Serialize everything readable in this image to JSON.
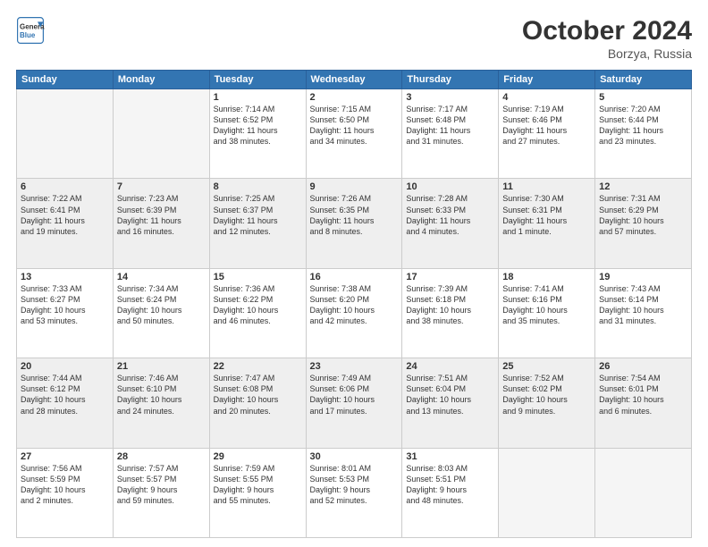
{
  "header": {
    "logo_line1": "General",
    "logo_line2": "Blue",
    "month_year": "October 2024",
    "location": "Borzya, Russia"
  },
  "weekdays": [
    "Sunday",
    "Monday",
    "Tuesday",
    "Wednesday",
    "Thursday",
    "Friday",
    "Saturday"
  ],
  "weeks": [
    [
      {
        "day": "",
        "info": ""
      },
      {
        "day": "",
        "info": ""
      },
      {
        "day": "1",
        "info": "Sunrise: 7:14 AM\nSunset: 6:52 PM\nDaylight: 11 hours\nand 38 minutes."
      },
      {
        "day": "2",
        "info": "Sunrise: 7:15 AM\nSunset: 6:50 PM\nDaylight: 11 hours\nand 34 minutes."
      },
      {
        "day": "3",
        "info": "Sunrise: 7:17 AM\nSunset: 6:48 PM\nDaylight: 11 hours\nand 31 minutes."
      },
      {
        "day": "4",
        "info": "Sunrise: 7:19 AM\nSunset: 6:46 PM\nDaylight: 11 hours\nand 27 minutes."
      },
      {
        "day": "5",
        "info": "Sunrise: 7:20 AM\nSunset: 6:44 PM\nDaylight: 11 hours\nand 23 minutes."
      }
    ],
    [
      {
        "day": "6",
        "info": "Sunrise: 7:22 AM\nSunset: 6:41 PM\nDaylight: 11 hours\nand 19 minutes."
      },
      {
        "day": "7",
        "info": "Sunrise: 7:23 AM\nSunset: 6:39 PM\nDaylight: 11 hours\nand 16 minutes."
      },
      {
        "day": "8",
        "info": "Sunrise: 7:25 AM\nSunset: 6:37 PM\nDaylight: 11 hours\nand 12 minutes."
      },
      {
        "day": "9",
        "info": "Sunrise: 7:26 AM\nSunset: 6:35 PM\nDaylight: 11 hours\nand 8 minutes."
      },
      {
        "day": "10",
        "info": "Sunrise: 7:28 AM\nSunset: 6:33 PM\nDaylight: 11 hours\nand 4 minutes."
      },
      {
        "day": "11",
        "info": "Sunrise: 7:30 AM\nSunset: 6:31 PM\nDaylight: 11 hours\nand 1 minute."
      },
      {
        "day": "12",
        "info": "Sunrise: 7:31 AM\nSunset: 6:29 PM\nDaylight: 10 hours\nand 57 minutes."
      }
    ],
    [
      {
        "day": "13",
        "info": "Sunrise: 7:33 AM\nSunset: 6:27 PM\nDaylight: 10 hours\nand 53 minutes."
      },
      {
        "day": "14",
        "info": "Sunrise: 7:34 AM\nSunset: 6:24 PM\nDaylight: 10 hours\nand 50 minutes."
      },
      {
        "day": "15",
        "info": "Sunrise: 7:36 AM\nSunset: 6:22 PM\nDaylight: 10 hours\nand 46 minutes."
      },
      {
        "day": "16",
        "info": "Sunrise: 7:38 AM\nSunset: 6:20 PM\nDaylight: 10 hours\nand 42 minutes."
      },
      {
        "day": "17",
        "info": "Sunrise: 7:39 AM\nSunset: 6:18 PM\nDaylight: 10 hours\nand 38 minutes."
      },
      {
        "day": "18",
        "info": "Sunrise: 7:41 AM\nSunset: 6:16 PM\nDaylight: 10 hours\nand 35 minutes."
      },
      {
        "day": "19",
        "info": "Sunrise: 7:43 AM\nSunset: 6:14 PM\nDaylight: 10 hours\nand 31 minutes."
      }
    ],
    [
      {
        "day": "20",
        "info": "Sunrise: 7:44 AM\nSunset: 6:12 PM\nDaylight: 10 hours\nand 28 minutes."
      },
      {
        "day": "21",
        "info": "Sunrise: 7:46 AM\nSunset: 6:10 PM\nDaylight: 10 hours\nand 24 minutes."
      },
      {
        "day": "22",
        "info": "Sunrise: 7:47 AM\nSunset: 6:08 PM\nDaylight: 10 hours\nand 20 minutes."
      },
      {
        "day": "23",
        "info": "Sunrise: 7:49 AM\nSunset: 6:06 PM\nDaylight: 10 hours\nand 17 minutes."
      },
      {
        "day": "24",
        "info": "Sunrise: 7:51 AM\nSunset: 6:04 PM\nDaylight: 10 hours\nand 13 minutes."
      },
      {
        "day": "25",
        "info": "Sunrise: 7:52 AM\nSunset: 6:02 PM\nDaylight: 10 hours\nand 9 minutes."
      },
      {
        "day": "26",
        "info": "Sunrise: 7:54 AM\nSunset: 6:01 PM\nDaylight: 10 hours\nand 6 minutes."
      }
    ],
    [
      {
        "day": "27",
        "info": "Sunrise: 7:56 AM\nSunset: 5:59 PM\nDaylight: 10 hours\nand 2 minutes."
      },
      {
        "day": "28",
        "info": "Sunrise: 7:57 AM\nSunset: 5:57 PM\nDaylight: 9 hours\nand 59 minutes."
      },
      {
        "day": "29",
        "info": "Sunrise: 7:59 AM\nSunset: 5:55 PM\nDaylight: 9 hours\nand 55 minutes."
      },
      {
        "day": "30",
        "info": "Sunrise: 8:01 AM\nSunset: 5:53 PM\nDaylight: 9 hours\nand 52 minutes."
      },
      {
        "day": "31",
        "info": "Sunrise: 8:03 AM\nSunset: 5:51 PM\nDaylight: 9 hours\nand 48 minutes."
      },
      {
        "day": "",
        "info": ""
      },
      {
        "day": "",
        "info": ""
      }
    ]
  ]
}
